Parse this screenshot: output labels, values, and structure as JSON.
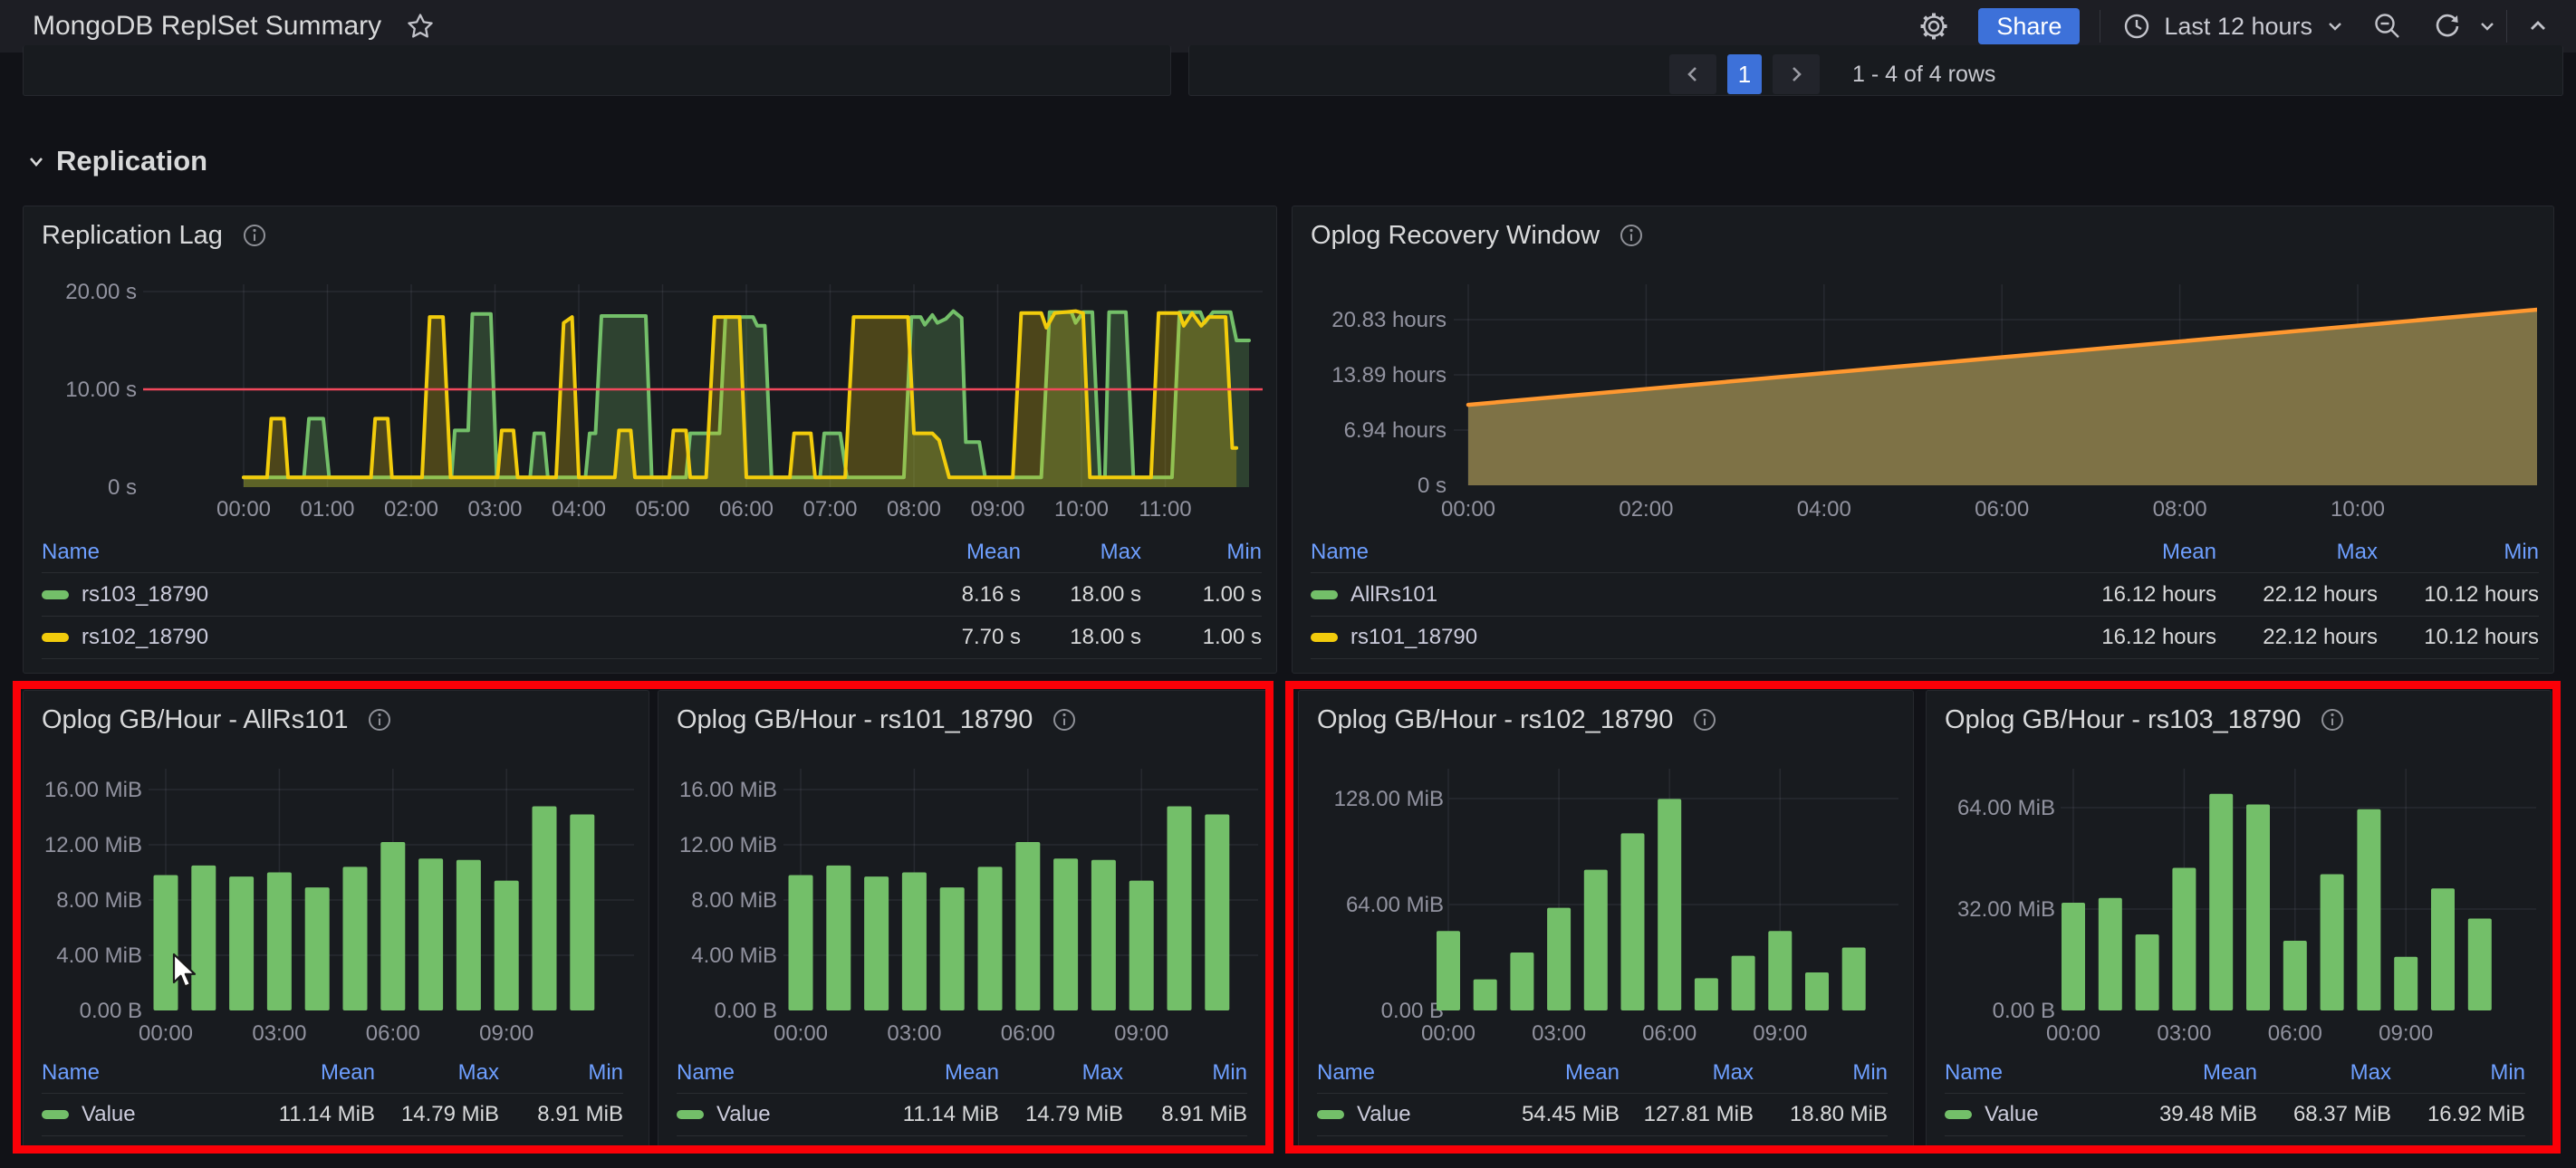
{
  "header": {
    "title": "MongoDB ReplSet Summary",
    "share_label": "Share",
    "time_label": "Last 12 hours"
  },
  "pagination": {
    "page": "1",
    "info": "1 - 4 of 4 rows"
  },
  "section": {
    "title": "Replication"
  },
  "legend_columns": [
    "Name",
    "Mean",
    "Max",
    "Min"
  ],
  "colors": {
    "page_bg": "#111217",
    "panel_bg": "#181b1f",
    "accent_blue": "#3d71d9",
    "legend_header_blue": "#6e9fff",
    "series_green": "#73bf69",
    "series_yellow": "#f2cc0c",
    "series_orange": "#ff9830",
    "threshold_red": "#f2495c",
    "annotation_red": "#fb0007"
  },
  "panels": {
    "replication_lag": {
      "title": "Replication Lag",
      "legend": [
        {
          "name": "rs103_18790",
          "color": "#73bf69",
          "mean": "8.16 s",
          "max": "18.00 s",
          "min": "1.00 s"
        },
        {
          "name": "rs102_18790",
          "color": "#f2cc0c",
          "mean": "7.70 s",
          "max": "18.00 s",
          "min": "1.00 s"
        }
      ]
    },
    "oplog_recovery_window": {
      "title": "Oplog Recovery Window",
      "legend": [
        {
          "name": "AllRs101",
          "color": "#73bf69",
          "mean": "16.12 hours",
          "max": "22.12 hours",
          "min": "10.12 hours"
        },
        {
          "name": "rs101_18790",
          "color": "#f2cc0c",
          "mean": "16.12 hours",
          "max": "22.12 hours",
          "min": "10.12 hours"
        }
      ]
    },
    "oplog_allrs101": {
      "title": "Oplog GB/Hour - AllRs101",
      "legend": [
        {
          "name": "Value",
          "color": "#73bf69",
          "mean": "11.14 MiB",
          "max": "14.79 MiB",
          "min": "8.91 MiB"
        }
      ]
    },
    "oplog_rs101": {
      "title": "Oplog GB/Hour - rs101_18790",
      "legend": [
        {
          "name": "Value",
          "color": "#73bf69",
          "mean": "11.14 MiB",
          "max": "14.79 MiB",
          "min": "8.91 MiB"
        }
      ]
    },
    "oplog_rs102": {
      "title": "Oplog GB/Hour - rs102_18790",
      "legend": [
        {
          "name": "Value",
          "color": "#73bf69",
          "mean": "54.45 MiB",
          "max": "127.81 MiB",
          "min": "18.80 MiB"
        }
      ]
    },
    "oplog_rs103": {
      "title": "Oplog GB/Hour - rs103_18790",
      "legend": [
        {
          "name": "Value",
          "color": "#73bf69",
          "mean": "39.48 MiB",
          "max": "68.37 MiB",
          "min": "16.92 MiB"
        }
      ]
    }
  },
  "chart_data": [
    {
      "id": "replication_lag",
      "type": "line",
      "title": "Replication Lag",
      "unit": "seconds",
      "ylim": [
        0,
        21
      ],
      "grid": true,
      "legend_position": "bottom",
      "y_ticks": [
        {
          "v": 20,
          "label": "20.00 s"
        },
        {
          "v": 10,
          "label": "10.00 s"
        },
        {
          "v": 0,
          "label": "0 s"
        }
      ],
      "x_ticks": [
        {
          "t": 0,
          "label": "00:00"
        },
        {
          "t": 1,
          "label": "01:00"
        },
        {
          "t": 2,
          "label": "02:00"
        },
        {
          "t": 3,
          "label": "03:00"
        },
        {
          "t": 4,
          "label": "04:00"
        },
        {
          "t": 5,
          "label": "05:00"
        },
        {
          "t": 6,
          "label": "06:00"
        },
        {
          "t": 7,
          "label": "07:00"
        },
        {
          "t": 8,
          "label": "08:00"
        },
        {
          "t": 9,
          "label": "09:00"
        },
        {
          "t": 10,
          "label": "10:00"
        },
        {
          "t": 11,
          "label": "11:00"
        }
      ],
      "threshold": {
        "v": 10,
        "color": "#f2495c"
      },
      "series": [
        {
          "name": "rs103_18790",
          "color": "#73bf69",
          "points": [
            [
              0,
              1
            ],
            [
              0.72,
              1
            ],
            [
              0.78,
              7
            ],
            [
              0.95,
              7
            ],
            [
              1.02,
              1
            ],
            [
              2.48,
              1
            ],
            [
              2.52,
              5.8
            ],
            [
              2.68,
              5.8
            ],
            [
              2.73,
              17.7
            ],
            [
              2.95,
              17.7
            ],
            [
              3.02,
              1
            ],
            [
              3.42,
              1
            ],
            [
              3.47,
              5.5
            ],
            [
              3.58,
              5.5
            ],
            [
              3.63,
              1
            ],
            [
              4.08,
              1
            ],
            [
              4.13,
              5.5
            ],
            [
              4.2,
              5.5
            ],
            [
              4.27,
              17.5
            ],
            [
              4.8,
              17.5
            ],
            [
              4.87,
              1
            ],
            [
              5.28,
              1
            ],
            [
              5.33,
              5.5
            ],
            [
              5.68,
              5.5
            ],
            [
              5.75,
              17.4
            ],
            [
              6.08,
              17.4
            ],
            [
              6.13,
              16.5
            ],
            [
              6.22,
              16.5
            ],
            [
              6.3,
              1
            ],
            [
              6.88,
              1
            ],
            [
              6.93,
              5.5
            ],
            [
              7.12,
              5.5
            ],
            [
              7.2,
              1
            ],
            [
              7.88,
              1
            ],
            [
              7.97,
              17.4
            ],
            [
              8.08,
              17.4
            ],
            [
              8.13,
              16.6
            ],
            [
              8.22,
              17.6
            ],
            [
              8.28,
              16.8
            ],
            [
              8.38,
              17.2
            ],
            [
              8.47,
              18
            ],
            [
              8.57,
              17.3
            ],
            [
              8.62,
              4.6
            ],
            [
              8.78,
              4.6
            ],
            [
              8.85,
              1
            ],
            [
              9.52,
              1
            ],
            [
              9.62,
              17.9
            ],
            [
              9.88,
              17.9
            ],
            [
              9.93,
              16.8
            ],
            [
              10.02,
              17.9
            ],
            [
              10.13,
              17.9
            ],
            [
              10.22,
              1
            ],
            [
              10.28,
              1
            ],
            [
              10.33,
              17.9
            ],
            [
              10.53,
              17.9
            ],
            [
              10.62,
              1
            ],
            [
              11.08,
              1
            ],
            [
              11.17,
              17.9
            ],
            [
              11.42,
              17.9
            ],
            [
              11.47,
              16.8
            ],
            [
              11.57,
              17.9
            ],
            [
              11.78,
              17.9
            ],
            [
              11.85,
              15
            ],
            [
              12.0,
              15
            ]
          ]
        },
        {
          "name": "rs102_18790",
          "color": "#f2cc0c",
          "points": [
            [
              0,
              1
            ],
            [
              0.28,
              1
            ],
            [
              0.33,
              7
            ],
            [
              0.48,
              7
            ],
            [
              0.53,
              1
            ],
            [
              1.52,
              1
            ],
            [
              1.57,
              7
            ],
            [
              1.72,
              7
            ],
            [
              1.77,
              1
            ],
            [
              2.13,
              1
            ],
            [
              2.22,
              17.4
            ],
            [
              2.38,
              17.4
            ],
            [
              2.47,
              1
            ],
            [
              3.03,
              1
            ],
            [
              3.08,
              5.8
            ],
            [
              3.22,
              5.8
            ],
            [
              3.27,
              1
            ],
            [
              3.73,
              1
            ],
            [
              3.82,
              16.8
            ],
            [
              3.92,
              17.4
            ],
            [
              4.0,
              1
            ],
            [
              4.43,
              1
            ],
            [
              4.48,
              5.8
            ],
            [
              4.62,
              5.8
            ],
            [
              4.67,
              1
            ],
            [
              5.08,
              1
            ],
            [
              5.13,
              5.8
            ],
            [
              5.28,
              5.8
            ],
            [
              5.33,
              1
            ],
            [
              5.52,
              1
            ],
            [
              5.62,
              17.4
            ],
            [
              5.92,
              17.4
            ],
            [
              6.0,
              1
            ],
            [
              6.52,
              1
            ],
            [
              6.57,
              5.5
            ],
            [
              6.77,
              5.5
            ],
            [
              6.82,
              1
            ],
            [
              7.18,
              1
            ],
            [
              7.28,
              17.4
            ],
            [
              7.93,
              17.4
            ],
            [
              8.0,
              5.5
            ],
            [
              8.22,
              5.5
            ],
            [
              8.3,
              4.8
            ],
            [
              8.42,
              1
            ],
            [
              9.18,
              1
            ],
            [
              9.28,
              17.8
            ],
            [
              9.52,
              17.8
            ],
            [
              9.58,
              16.3
            ],
            [
              9.68,
              17.8
            ],
            [
              9.93,
              18
            ],
            [
              10.02,
              17.8
            ],
            [
              10.1,
              1
            ],
            [
              10.83,
              1
            ],
            [
              10.92,
              17.8
            ],
            [
              11.17,
              17.8
            ],
            [
              11.22,
              16.5
            ],
            [
              11.32,
              17.8
            ],
            [
              11.43,
              16.5
            ],
            [
              11.52,
              17.4
            ],
            [
              11.72,
              17.4
            ],
            [
              11.8,
              4
            ],
            [
              11.85,
              4
            ]
          ]
        }
      ]
    },
    {
      "id": "oplog_recovery_window",
      "type": "area",
      "title": "Oplog Recovery Window",
      "unit": "hours",
      "ylim": [
        0,
        23.2
      ],
      "grid": true,
      "legend_position": "bottom",
      "y_ticks": [
        {
          "v": 20.83,
          "label": "20.83 hours"
        },
        {
          "v": 13.89,
          "label": "13.89 hours"
        },
        {
          "v": 6.94,
          "label": "6.94 hours"
        },
        {
          "v": 0,
          "label": "0 s"
        }
      ],
      "x_ticks": [
        {
          "t": 0,
          "label": "00:00"
        },
        {
          "t": 2,
          "label": "02:00"
        },
        {
          "t": 4,
          "label": "04:00"
        },
        {
          "t": 6,
          "label": "06:00"
        },
        {
          "t": 8,
          "label": "08:00"
        },
        {
          "t": 10,
          "label": "10:00"
        }
      ],
      "series": [
        {
          "name": "AllRs101 / rs101_18790",
          "color": "#ff9830",
          "fill": "#7e7246",
          "points": [
            [
              0,
              10.12
            ],
            [
              12.05,
              22.12
            ]
          ]
        }
      ]
    },
    {
      "id": "oplog_allrs101",
      "type": "bar",
      "title": "Oplog GB/Hour - AllRs101",
      "unit": "MiB",
      "ylim": [
        0,
        17.4
      ],
      "grid": true,
      "bar_color": "#73bf69",
      "categories": [
        "00:00",
        "01:00",
        "02:00",
        "03:00",
        "04:00",
        "05:00",
        "06:00",
        "07:00",
        "08:00",
        "09:00",
        "10:00",
        "11:00"
      ],
      "values": [
        9.8,
        10.5,
        9.7,
        10.0,
        8.91,
        10.4,
        12.2,
        11.0,
        10.9,
        9.4,
        14.79,
        14.2
      ],
      "y_ticks": [
        {
          "v": 16,
          "label": "16.00 MiB"
        },
        {
          "v": 12,
          "label": "12.00 MiB"
        },
        {
          "v": 8,
          "label": "8.00 MiB"
        },
        {
          "v": 4,
          "label": "4.00 MiB"
        },
        {
          "v": 0,
          "label": "0.00 B"
        }
      ],
      "x_ticks": [
        {
          "i": 0,
          "label": "00:00"
        },
        {
          "i": 3,
          "label": "03:00"
        },
        {
          "i": 6,
          "label": "06:00"
        },
        {
          "i": 9,
          "label": "09:00"
        }
      ]
    },
    {
      "id": "oplog_rs101",
      "type": "bar",
      "title": "Oplog GB/Hour - rs101_18790",
      "unit": "MiB",
      "ylim": [
        0,
        17.4
      ],
      "grid": true,
      "bar_color": "#73bf69",
      "categories": [
        "00:00",
        "01:00",
        "02:00",
        "03:00",
        "04:00",
        "05:00",
        "06:00",
        "07:00",
        "08:00",
        "09:00",
        "10:00",
        "11:00"
      ],
      "values": [
        9.8,
        10.5,
        9.7,
        10.0,
        8.91,
        10.4,
        12.2,
        11.0,
        10.9,
        9.4,
        14.79,
        14.2
      ],
      "y_ticks": [
        {
          "v": 16,
          "label": "16.00 MiB"
        },
        {
          "v": 12,
          "label": "12.00 MiB"
        },
        {
          "v": 8,
          "label": "8.00 MiB"
        },
        {
          "v": 4,
          "label": "4.00 MiB"
        },
        {
          "v": 0,
          "label": "0.00 B"
        }
      ],
      "x_ticks": [
        {
          "i": 0,
          "label": "00:00"
        },
        {
          "i": 3,
          "label": "03:00"
        },
        {
          "i": 6,
          "label": "06:00"
        },
        {
          "i": 9,
          "label": "09:00"
        }
      ]
    },
    {
      "id": "oplog_rs102",
      "type": "bar",
      "title": "Oplog GB/Hour - rs102_18790",
      "unit": "MiB",
      "ylim": [
        0,
        145
      ],
      "grid": true,
      "bar_color": "#73bf69",
      "categories": [
        "00:00",
        "01:00",
        "02:00",
        "03:00",
        "04:00",
        "05:00",
        "06:00",
        "07:00",
        "08:00",
        "09:00",
        "10:00",
        "11:00"
      ],
      "values": [
        48,
        18.8,
        35,
        62,
        85,
        107,
        127.81,
        19.5,
        33,
        48,
        23,
        38
      ],
      "y_ticks": [
        {
          "v": 128,
          "label": "128.00 MiB"
        },
        {
          "v": 64,
          "label": "64.00 MiB"
        },
        {
          "v": 0,
          "label": "0.00 B"
        }
      ],
      "x_ticks": [
        {
          "i": 0,
          "label": "00:00"
        },
        {
          "i": 3,
          "label": "03:00"
        },
        {
          "i": 6,
          "label": "06:00"
        },
        {
          "i": 9,
          "label": "09:00"
        }
      ]
    },
    {
      "id": "oplog_rs103",
      "type": "bar",
      "title": "Oplog GB/Hour - rs103_18790",
      "unit": "MiB",
      "ylim": [
        0,
        75.7
      ],
      "grid": true,
      "bar_color": "#73bf69",
      "categories": [
        "00:00",
        "01:00",
        "02:00",
        "03:00",
        "04:00",
        "05:00",
        "06:00",
        "07:00",
        "08:00",
        "09:00",
        "10:00",
        "11:00"
      ],
      "values": [
        34,
        35.5,
        24,
        45,
        68.37,
        65,
        22,
        43,
        63.5,
        16.92,
        38.5,
        29
      ],
      "y_ticks": [
        {
          "v": 64,
          "label": "64.00 MiB"
        },
        {
          "v": 32,
          "label": "32.00 MiB"
        },
        {
          "v": 0,
          "label": "0.00 B"
        }
      ],
      "x_ticks": [
        {
          "i": 0,
          "label": "00:00"
        },
        {
          "i": 3,
          "label": "03:00"
        },
        {
          "i": 6,
          "label": "06:00"
        },
        {
          "i": 9,
          "label": "09:00"
        }
      ]
    }
  ]
}
